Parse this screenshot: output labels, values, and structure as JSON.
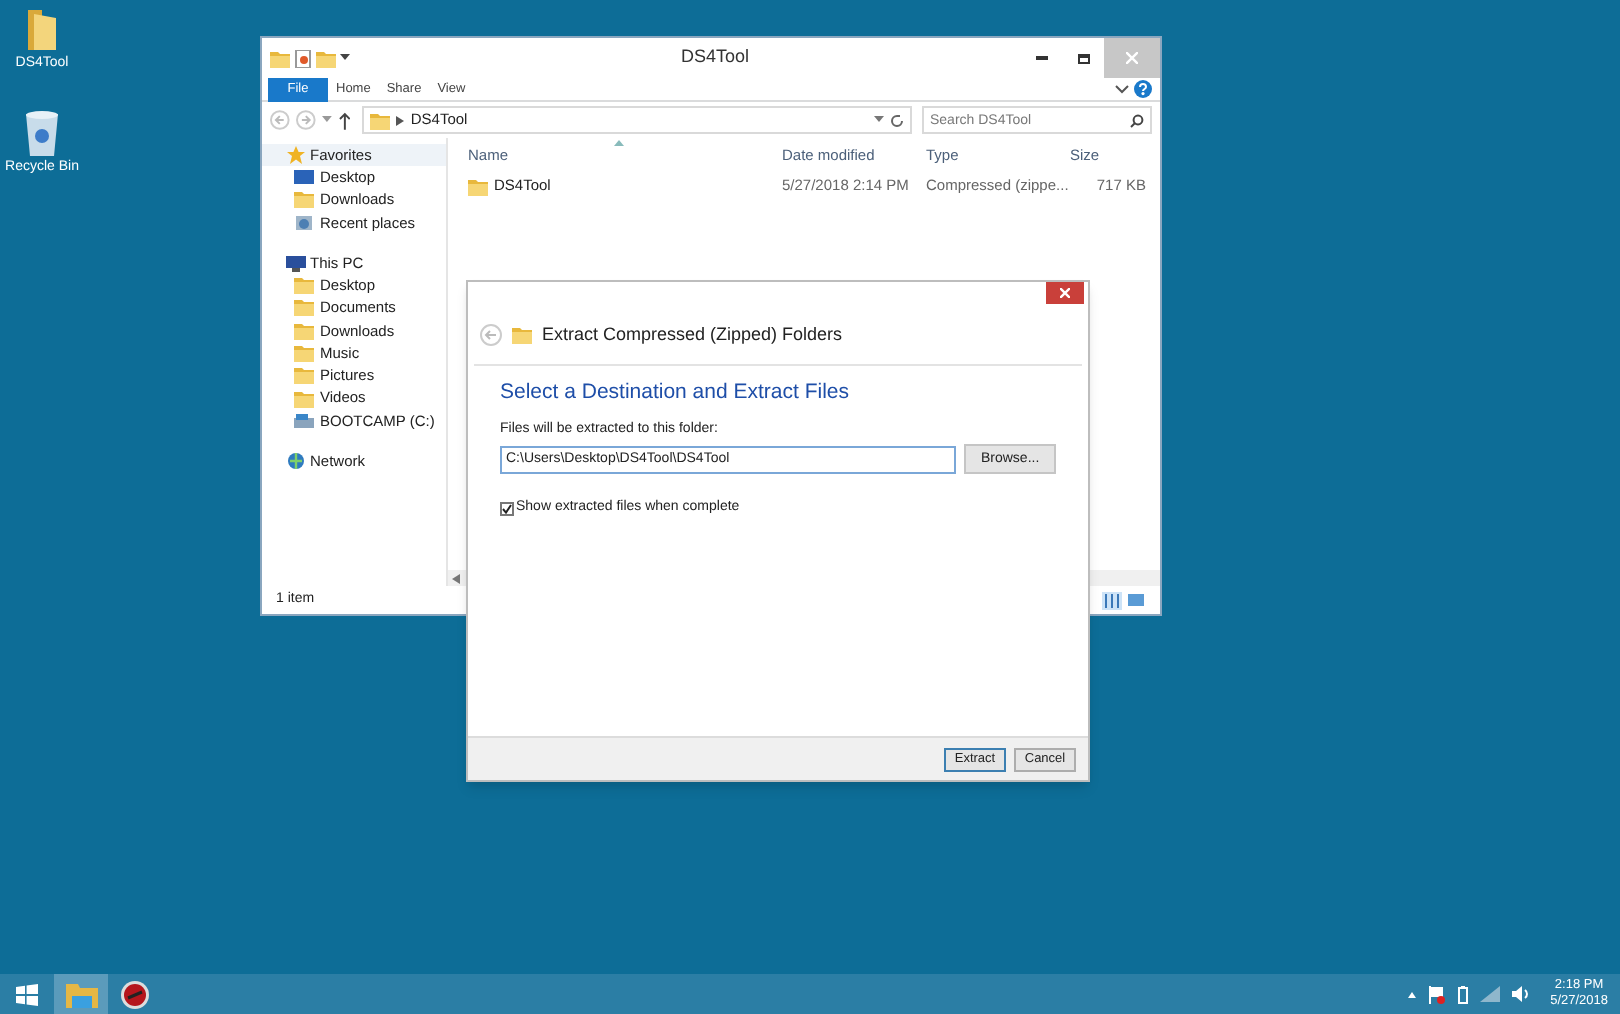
{
  "desktop_icons": [
    {
      "label": "DS4Tool",
      "kind": "folder"
    },
    {
      "label": "Recycle Bin",
      "kind": "bin"
    }
  ],
  "explorer": {
    "title": "DS4Tool",
    "ribbon_tabs": [
      {
        "label": "File",
        "kind": "menu"
      },
      {
        "label": "Home",
        "kind": "tab"
      },
      {
        "label": "Share",
        "kind": "tab"
      },
      {
        "label": "View",
        "kind": "tab"
      }
    ],
    "address": [
      "DS4Tool"
    ],
    "search": {
      "placeholder": "Search DS4Tool"
    },
    "nav": [
      {
        "label": "Favorites",
        "kind": "star",
        "selected": true,
        "children": [
          {
            "label": "Desktop",
            "kind": "desktop",
            "selected": false
          },
          {
            "label": "Downloads",
            "kind": "folder",
            "selected": false
          },
          {
            "label": "Recent places",
            "kind": "recent",
            "selected": false
          }
        ]
      },
      {
        "label": "This PC",
        "kind": "pc",
        "selected": false,
        "children": [
          {
            "label": "Desktop",
            "kind": "folder",
            "selected": false
          },
          {
            "label": "Documents",
            "kind": "folder",
            "selected": false
          },
          {
            "label": "Downloads",
            "kind": "folder",
            "selected": false
          },
          {
            "label": "Music",
            "kind": "folder",
            "selected": false
          },
          {
            "label": "Pictures",
            "kind": "folder",
            "selected": false
          },
          {
            "label": "Videos",
            "kind": "folder",
            "selected": false
          },
          {
            "label": "BOOTCAMP (C:)",
            "kind": "drive",
            "selected": false
          }
        ]
      },
      {
        "label": "Network",
        "kind": "network",
        "selected": false
      }
    ],
    "columns": [
      "Name",
      "Date modified",
      "Type",
      "Size"
    ],
    "rows": [
      {
        "name": "DS4Tool",
        "date": "5/27/2018 2:14 PM",
        "type": "Compressed (zippe...",
        "size": "717 KB"
      }
    ],
    "status": "1 item"
  },
  "dialog": {
    "title": "Extract Compressed (Zipped) Folders",
    "heading": "Select a Destination and Extract Files",
    "field_label": "Files will be extracted to this folder:",
    "path": "C:\\Users\\Desktop\\DS4Tool\\DS4Tool",
    "browse": "Browse...",
    "checkbox": {
      "label": "Show extracted files when complete",
      "checked": true
    },
    "buttons": [
      {
        "label": "Extract",
        "selected": true
      },
      {
        "label": "Cancel",
        "selected": false
      }
    ]
  },
  "taskbar": {
    "time": "2:18 PM",
    "date": "5/27/2018"
  }
}
